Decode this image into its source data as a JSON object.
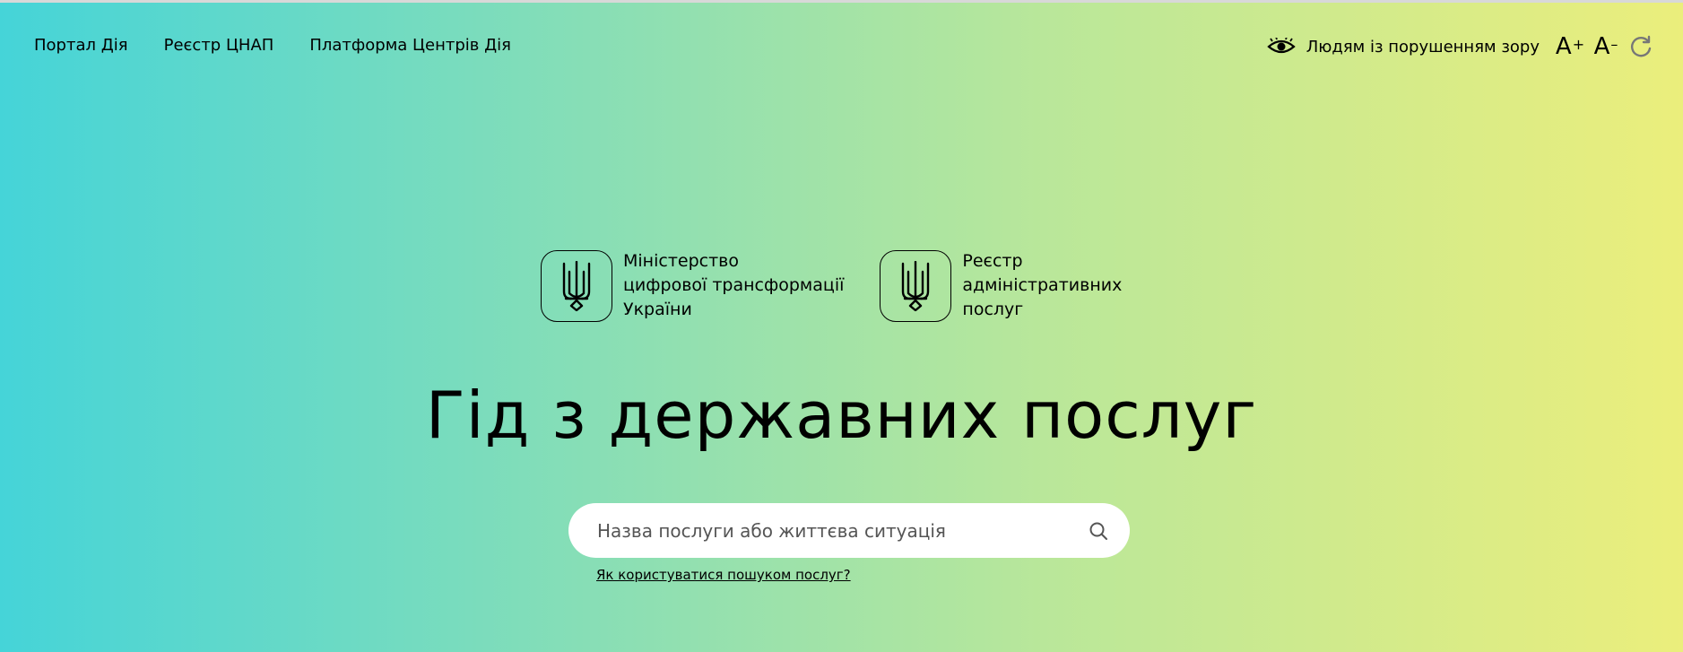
{
  "nav": {
    "items": [
      {
        "label": "Портал Дія"
      },
      {
        "label": "Реєстр ЦНАП"
      },
      {
        "label": "Платформа Центрів Дія"
      }
    ]
  },
  "accessibility": {
    "label": "Людям із порушенням зору",
    "increase_label": "A",
    "increase_sign": "+",
    "decrease_label": "A",
    "decrease_sign": "–"
  },
  "logos": [
    {
      "text": "Міністерство\nцифрової трансформації\nУкраїни"
    },
    {
      "text": "Реєстр\nадміністративних\nпослуг"
    }
  ],
  "hero": {
    "title": "Гід з державних послуг"
  },
  "search": {
    "placeholder": "Назва послуги або життєва ситуація",
    "help_link": "Як користуватися пошуком послуг?"
  },
  "icons": {
    "vision": "eye-icon",
    "reset": "refresh-icon",
    "search": "search-icon",
    "emblem": "trident-icon"
  }
}
